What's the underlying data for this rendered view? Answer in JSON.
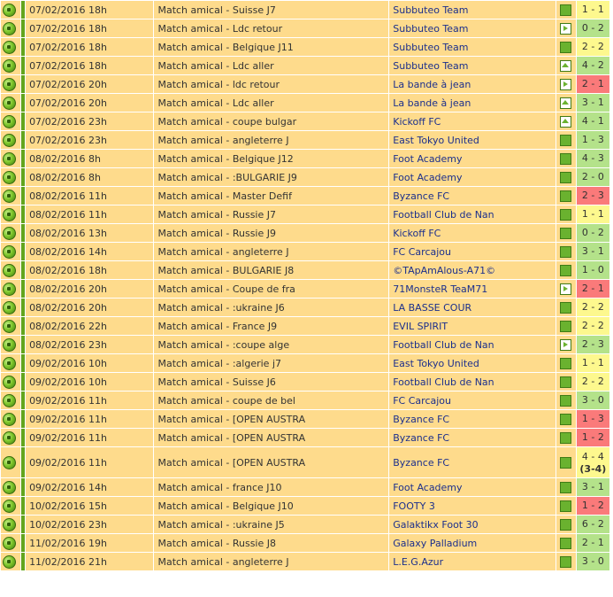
{
  "colors": {
    "row_bg": "#fedb8c",
    "draw": "#fdf88e",
    "win": "#b4e28a",
    "loss": "#fa7a7a",
    "team_link": "#1b2f8c",
    "strip": "#62a51d"
  },
  "icons": {
    "match_ball": "soccer-ball-icon",
    "neutral": "neutral-venue-icon",
    "away": "away-arrow-icon",
    "home": "home-icon"
  },
  "matches": [
    {
      "date": "07/02/2016 18h",
      "competition": "Match amical - Suisse J7",
      "opponent": "Subbuteo Team",
      "venue": "neutral",
      "score": "1 - 1",
      "result": "draw"
    },
    {
      "date": "07/02/2016 18h",
      "competition": "Match amical - Ldc retour",
      "opponent": "Subbuteo Team",
      "venue": "away",
      "score": "0 - 2",
      "result": "win"
    },
    {
      "date": "07/02/2016 18h",
      "competition": "Match amical - Belgique J11",
      "opponent": "Subbuteo Team",
      "venue": "neutral",
      "score": "2 - 2",
      "result": "draw"
    },
    {
      "date": "07/02/2016 18h",
      "competition": "Match amical - Ldc aller",
      "opponent": "Subbuteo Team",
      "venue": "home",
      "score": "4 - 2",
      "result": "win"
    },
    {
      "date": "07/02/2016 20h",
      "competition": "Match amical - ldc retour",
      "opponent": "La bande à jean",
      "venue": "away",
      "score": "2 - 1",
      "result": "loss"
    },
    {
      "date": "07/02/2016 20h",
      "competition": "Match amical - Ldc aller",
      "opponent": "La bande à jean",
      "venue": "home",
      "score": "3 - 1",
      "result": "win"
    },
    {
      "date": "07/02/2016 23h",
      "competition": "Match amical - coupe bulgar",
      "opponent": "Kickoff FC",
      "venue": "home",
      "score": "4 - 1",
      "result": "win"
    },
    {
      "date": "07/02/2016 23h",
      "competition": "Match amical - angleterre J",
      "opponent": "East Tokyo United",
      "venue": "neutral",
      "score": "1 - 3",
      "result": "win"
    },
    {
      "date": "08/02/2016 8h",
      "competition": "Match amical - Belgique J12",
      "opponent": "Foot Academy",
      "venue": "neutral",
      "score": "4 - 3",
      "result": "win"
    },
    {
      "date": "08/02/2016 8h",
      "competition": "Match amical - :BULGARIE J9",
      "opponent": "Foot Academy",
      "venue": "neutral",
      "score": "2 - 0",
      "result": "win"
    },
    {
      "date": "08/02/2016 11h",
      "competition": "Match amical - Master Defif",
      "opponent": "Byzance FC",
      "venue": "neutral",
      "score": "2 - 3",
      "result": "loss"
    },
    {
      "date": "08/02/2016 11h",
      "competition": "Match amical - Russie J7",
      "opponent": "Football Club de Nan",
      "venue": "neutral",
      "score": "1 - 1",
      "result": "draw"
    },
    {
      "date": "08/02/2016 13h",
      "competition": "Match amical - Russie J9",
      "opponent": "Kickoff FC",
      "venue": "neutral",
      "score": "0 - 2",
      "result": "win"
    },
    {
      "date": "08/02/2016 14h",
      "competition": "Match amical - angleterre J",
      "opponent": "FC Carcajou",
      "venue": "neutral",
      "score": "3 - 1",
      "result": "win"
    },
    {
      "date": "08/02/2016 18h",
      "competition": "Match amical - BULGARIE J8",
      "opponent": "©TApAmAlous-A71©",
      "venue": "neutral",
      "score": "1 - 0",
      "result": "win"
    },
    {
      "date": "08/02/2016 20h",
      "competition": "Match amical - Coupe de fra",
      "opponent": "71MonsteR TeaM71",
      "venue": "away",
      "score": "2 - 1",
      "result": "loss"
    },
    {
      "date": "08/02/2016 20h",
      "competition": "Match amical - :ukraine J6",
      "opponent": "LA BASSE COUR",
      "venue": "neutral",
      "score": "2 - 2",
      "result": "draw"
    },
    {
      "date": "08/02/2016 22h",
      "competition": "Match amical - France J9",
      "opponent": "EVIL SPIRIT",
      "venue": "neutral",
      "score": "2 - 2",
      "result": "draw"
    },
    {
      "date": "08/02/2016 23h",
      "competition": "Match amical - :coupe alge",
      "opponent": "Football Club de Nan",
      "venue": "away",
      "score": "2 - 3",
      "result": "win"
    },
    {
      "date": "09/02/2016 10h",
      "competition": "Match amical - :algerie j7",
      "opponent": "East Tokyo United",
      "venue": "neutral",
      "score": "1 - 1",
      "result": "draw"
    },
    {
      "date": "09/02/2016 10h",
      "competition": "Match amical - Suisse J6",
      "opponent": "Football Club de Nan",
      "venue": "neutral",
      "score": "2 - 2",
      "result": "draw"
    },
    {
      "date": "09/02/2016 11h",
      "competition": "Match amical - coupe de bel",
      "opponent": "FC Carcajou",
      "venue": "neutral",
      "score": "3 - 0",
      "result": "win"
    },
    {
      "date": "09/02/2016 11h",
      "competition": "Match amical - [OPEN AUSTRA",
      "opponent": "Byzance FC",
      "venue": "neutral",
      "score": "1 - 3",
      "result": "loss"
    },
    {
      "date": "09/02/2016 11h",
      "competition": "Match amical - [OPEN AUSTRA",
      "opponent": "Byzance FC",
      "venue": "neutral",
      "score": "1 - 2",
      "result": "loss"
    },
    {
      "date": "09/02/2016 11h",
      "competition": "Match amical - [OPEN AUSTRA",
      "opponent": "Byzance FC",
      "venue": "neutral",
      "score": "4 - 4",
      "extra": "(3-4)",
      "result": "draw"
    },
    {
      "date": "09/02/2016 14h",
      "competition": "Match amical - france J10",
      "opponent": "Foot Academy",
      "venue": "neutral",
      "score": "3 - 1",
      "result": "win"
    },
    {
      "date": "10/02/2016 15h",
      "competition": "Match amical - Belgique J10",
      "opponent": "FOOTY 3",
      "venue": "neutral",
      "score": "1 - 2",
      "result": "loss"
    },
    {
      "date": "10/02/2016 23h",
      "competition": "Match amical - :ukraine J5",
      "opponent": "Galaktikx Foot 30",
      "venue": "neutral",
      "score": "6 - 2",
      "result": "win"
    },
    {
      "date": "11/02/2016 19h",
      "competition": "Match amical - Russie J8",
      "opponent": "Galaxy Palladium",
      "venue": "neutral",
      "score": "2 - 1",
      "result": "win"
    },
    {
      "date": "11/02/2016 21h",
      "competition": "Match amical - angleterre J",
      "opponent": "L.E.G.Azur",
      "venue": "neutral",
      "score": "3 - 0",
      "result": "win"
    }
  ]
}
